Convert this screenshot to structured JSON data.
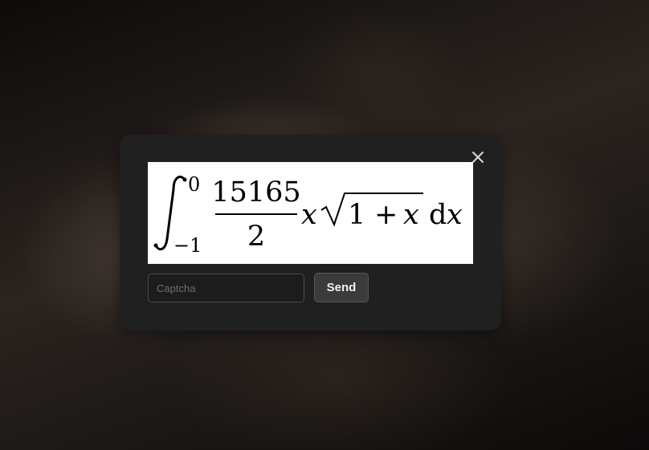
{
  "dialog": {
    "close_icon": "close-icon",
    "captcha": {
      "image_icon": "math-captcha-image",
      "integral_lower": "−1",
      "integral_upper": "0",
      "numerator": "15165",
      "denominator": "2",
      "variable": "x",
      "radicand_one": "1",
      "plus": "+",
      "radicand_x": "x",
      "differential_d": "d",
      "differential_x": "x"
    },
    "input": {
      "value": "",
      "placeholder": "Captcha"
    },
    "send_label": "Send"
  }
}
